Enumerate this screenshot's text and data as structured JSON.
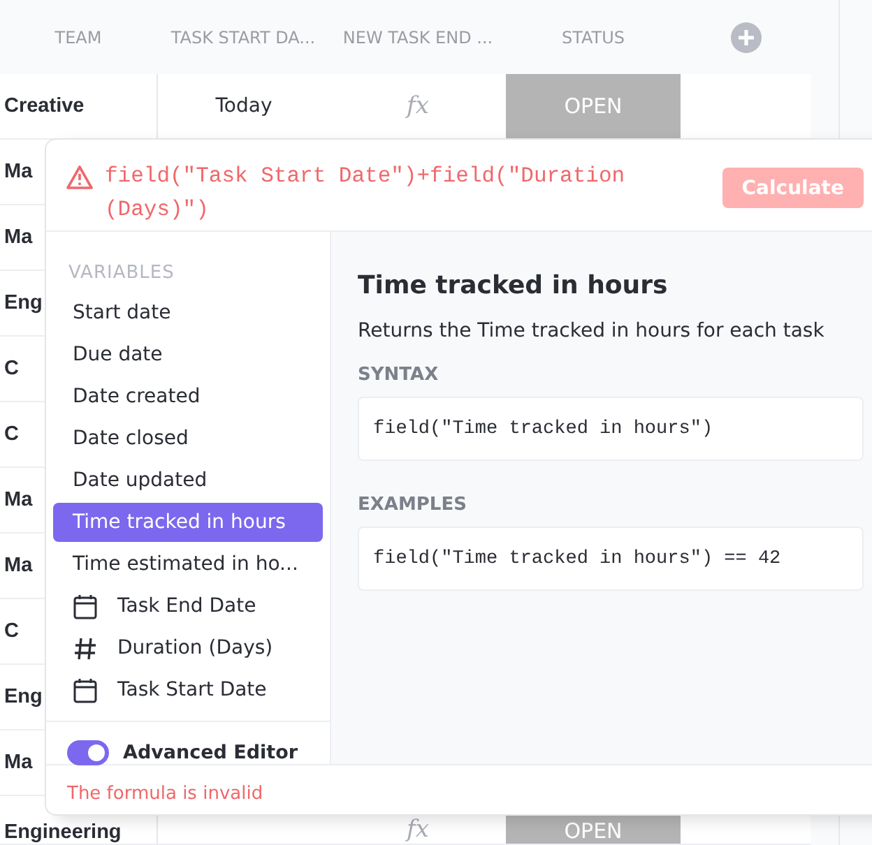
{
  "table": {
    "columns": [
      "TEAM",
      "TASK START DA...",
      "NEW TASK END ...",
      "STATUS"
    ],
    "rows": [
      {
        "team": "Creative",
        "start": "Today",
        "formula_mark": "fx",
        "status": "OPEN"
      },
      {
        "team": "Ma"
      },
      {
        "team": "Ma"
      },
      {
        "team": "Eng"
      },
      {
        "team": "C"
      },
      {
        "team": "C"
      },
      {
        "team": "Ma"
      },
      {
        "team": "Ma"
      },
      {
        "team": "C"
      },
      {
        "team": "Eng"
      },
      {
        "team": "Ma"
      },
      {
        "team": "Engineering",
        "formula_mark": "fx",
        "status": "OPEN"
      }
    ]
  },
  "formula_editor": {
    "formula": "field(\"Task Start Date\")+field(\"Duration (Days)\")",
    "valid": false,
    "calculate_button": {
      "label": "Calculate",
      "disabled": true
    },
    "variables_heading": "VARIABLES",
    "variables": [
      {
        "label": "Start date",
        "kind": "plain",
        "selected": false
      },
      {
        "label": "Due date",
        "kind": "plain",
        "selected": false
      },
      {
        "label": "Date created",
        "kind": "plain",
        "selected": false
      },
      {
        "label": "Date closed",
        "kind": "plain",
        "selected": false
      },
      {
        "label": "Date updated",
        "kind": "plain",
        "selected": false
      },
      {
        "label": "Time tracked in hours",
        "kind": "plain",
        "selected": true
      },
      {
        "label": "Time estimated in ho...",
        "kind": "plain",
        "selected": false
      },
      {
        "label": "Task End Date",
        "kind": "date",
        "selected": false
      },
      {
        "label": "Duration (Days)",
        "kind": "number",
        "selected": false
      },
      {
        "label": "Task Start Date",
        "kind": "date",
        "selected": false
      }
    ],
    "advanced_editor": {
      "label": "Advanced Editor",
      "on": true
    },
    "detail": {
      "title": "Time tracked in hours",
      "description": "Returns the Time tracked in hours for each task",
      "syntax_label": "SYNTAX",
      "syntax": "field(\"Time tracked in hours\")",
      "examples_label": "EXAMPLES",
      "example": "field(\"Time tracked in hours\") == 42"
    },
    "message": "The formula is invalid"
  }
}
